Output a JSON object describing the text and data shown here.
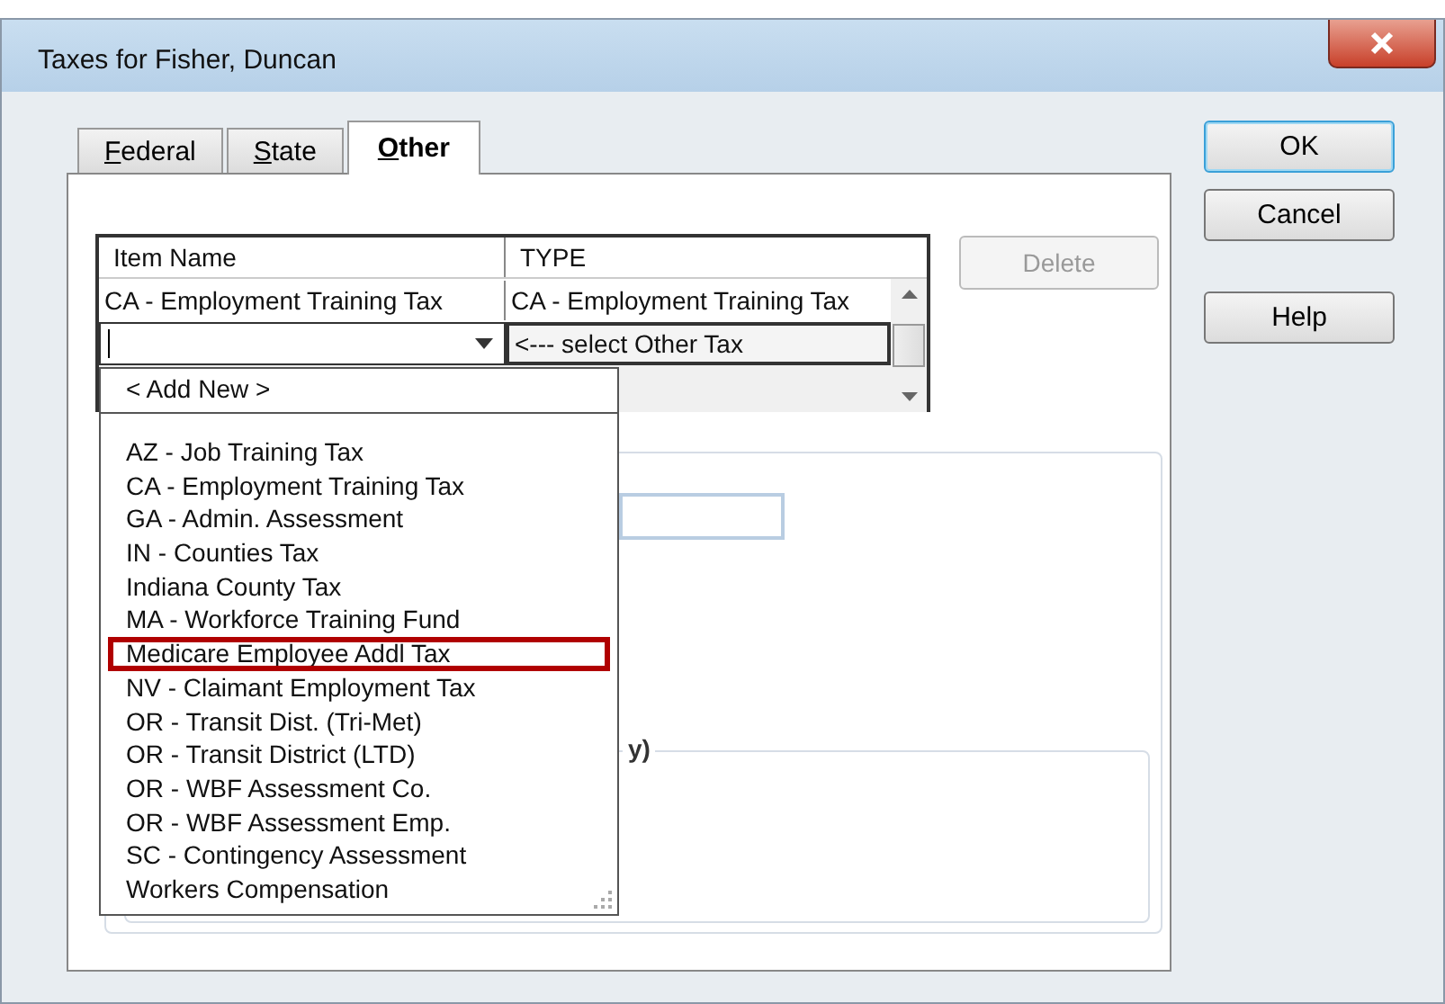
{
  "window": {
    "title": "Taxes for Fisher, Duncan"
  },
  "tabs": [
    {
      "label": "Federal",
      "selected": false
    },
    {
      "label": "State",
      "selected": false
    },
    {
      "label": "Other",
      "selected": true
    }
  ],
  "table": {
    "columns": [
      "Item Name",
      "TYPE"
    ],
    "rows": [
      {
        "item_name": "CA - Employment Training Tax",
        "type": "CA - Employment Training Tax"
      }
    ],
    "new_row": {
      "type": "<--- select Other Tax"
    }
  },
  "delete_button": {
    "label": "Delete",
    "disabled": true
  },
  "group_legend": "y)",
  "dropdown": {
    "add_new": "< Add New >",
    "items": [
      {
        "label": "AZ - Job Training Tax",
        "selected": false
      },
      {
        "label": "CA - Employment Training Tax",
        "selected": false
      },
      {
        "label": "GA - Admin. Assessment",
        "selected": false
      },
      {
        "label": "IN - Counties Tax",
        "selected": false
      },
      {
        "label": "Indiana County Tax",
        "selected": false
      },
      {
        "label": "MA - Workforce Training Fund",
        "selected": false
      },
      {
        "label": "Medicare Employee Addl Tax",
        "selected": true
      },
      {
        "label": "NV - Claimant Employment Tax",
        "selected": false
      },
      {
        "label": "OR - Transit Dist. (Tri-Met)",
        "selected": false
      },
      {
        "label": "OR - Transit District (LTD)",
        "selected": false
      },
      {
        "label": "OR - WBF Assessment Co.",
        "selected": false
      },
      {
        "label": "OR - WBF Assessment Emp.",
        "selected": false
      },
      {
        "label": "SC - Contingency Assessment",
        "selected": false
      },
      {
        "label": "Workers Compensation",
        "selected": false
      }
    ]
  },
  "buttons": [
    "OK",
    "Cancel",
    "Help"
  ]
}
